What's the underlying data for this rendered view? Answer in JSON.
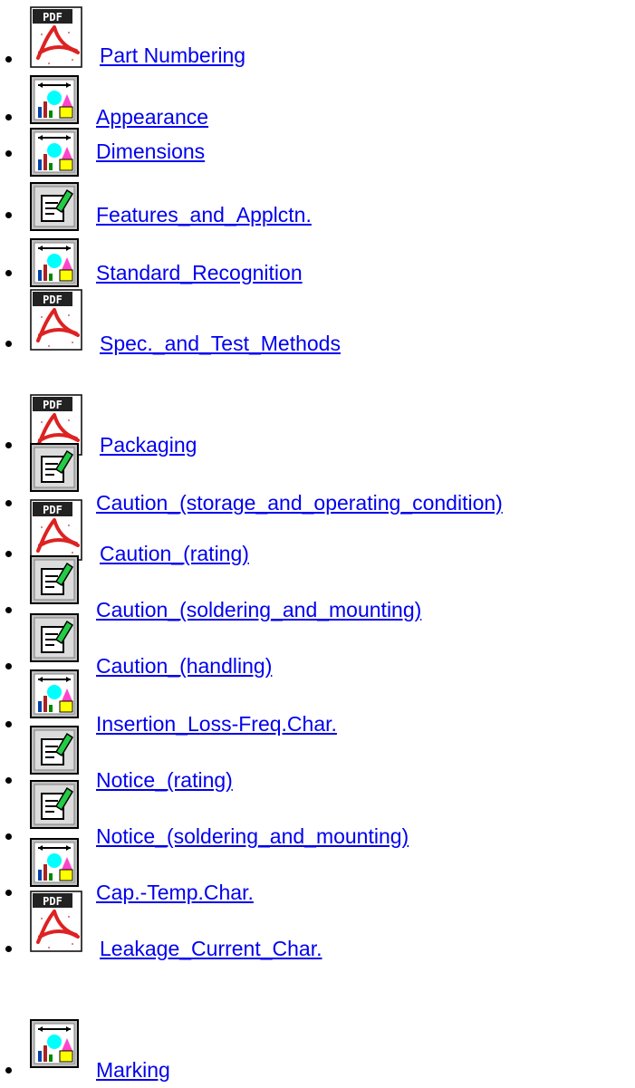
{
  "items": [
    {
      "icon": "pdf-icon",
      "label": "Part Numbering"
    },
    {
      "icon": "chart-icon",
      "label": "Appearance"
    },
    {
      "icon": "chart-icon",
      "label": "Dimensions"
    },
    {
      "icon": "edit-doc-icon",
      "label": "Features_and_Applctn."
    },
    {
      "icon": "chart-icon",
      "label": "Standard_Recognition"
    },
    {
      "icon": "pdf-icon",
      "label": "Spec._and_Test_Methods"
    },
    {
      "icon": "pdf-icon",
      "label": "Packaging"
    },
    {
      "icon": "edit-doc-icon",
      "label": "Caution_(storage_and_operating_condition)"
    },
    {
      "icon": "pdf-icon",
      "label": "Caution_(rating)"
    },
    {
      "icon": "edit-doc-icon",
      "label": "Caution_(soldering_and_mounting)"
    },
    {
      "icon": "edit-doc-icon",
      "label": "Caution_(handling)"
    },
    {
      "icon": "chart-icon",
      "label": "Insertion_Loss-Freq.Char."
    },
    {
      "icon": "edit-doc-icon",
      "label": "Notice_(rating)"
    },
    {
      "icon": "edit-doc-icon",
      "label": "Notice_(soldering_and_mounting)"
    },
    {
      "icon": "chart-icon",
      "label": "Cap.-Temp.Char."
    },
    {
      "icon": "pdf-icon",
      "label": "Leakage_Current_Char."
    },
    {
      "icon": "chart-icon",
      "label": "Marking"
    }
  ]
}
